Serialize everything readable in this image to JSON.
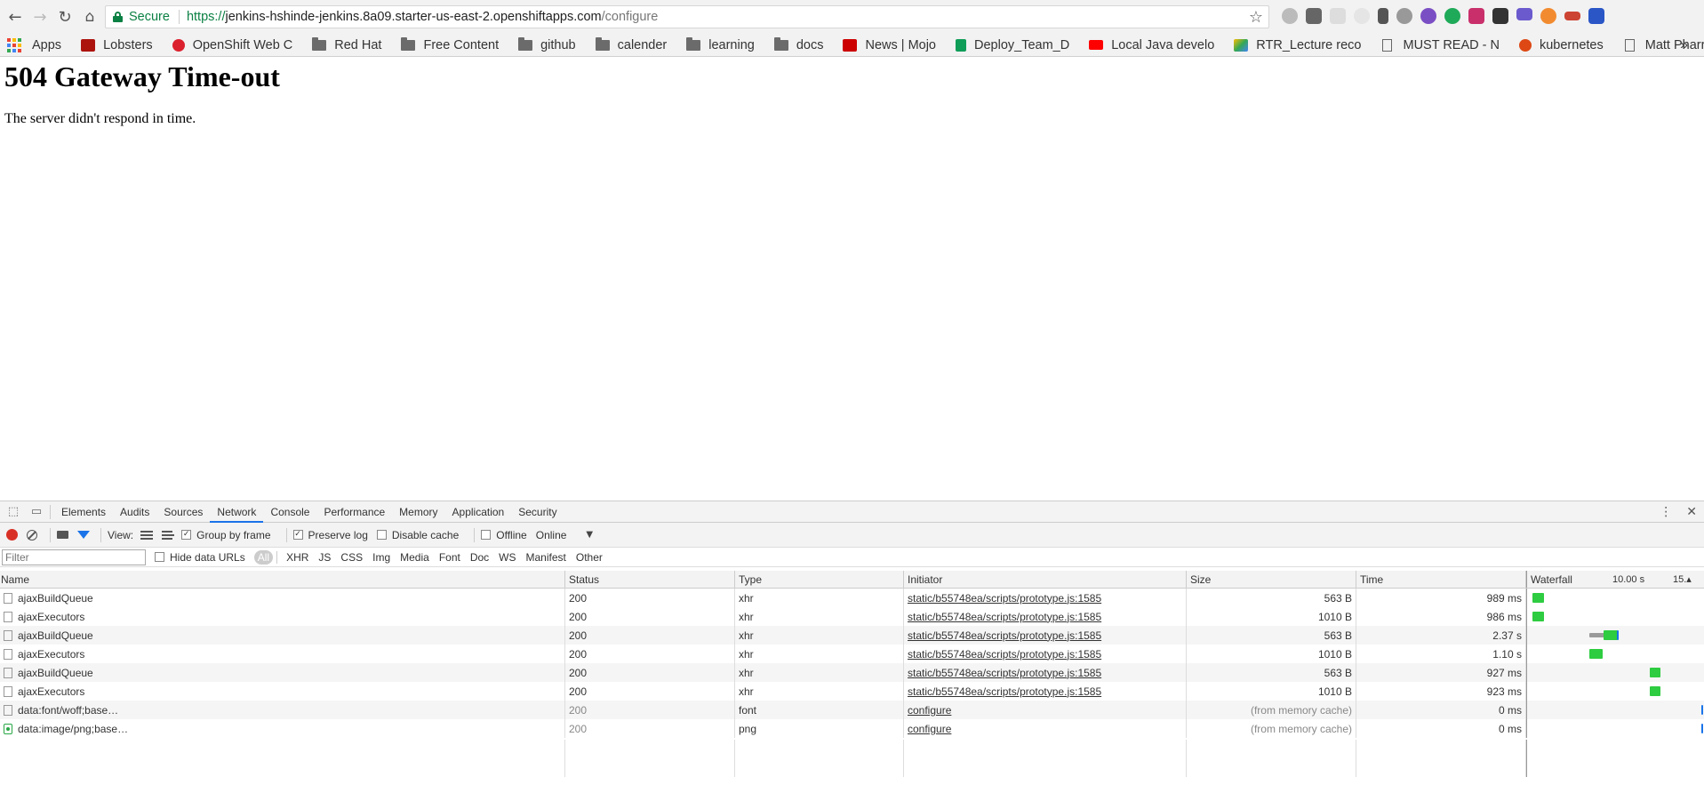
{
  "browser": {
    "secure_label": "Secure",
    "url_scheme": "https://",
    "url_host": "jenkins-hshinde-jenkins.8a09.starter-us-east-2.openshiftapps.com",
    "url_path": "/configure"
  },
  "bookmarks": {
    "apps": "Apps",
    "items": [
      {
        "label": "Lobsters",
        "icon": "lobsters-icon"
      },
      {
        "label": "OpenShift Web C",
        "icon": "openshift-icon"
      },
      {
        "label": "Red Hat",
        "icon": "folder-icon"
      },
      {
        "label": "Free Content",
        "icon": "folder-icon"
      },
      {
        "label": "github",
        "icon": "folder-icon"
      },
      {
        "label": "calender",
        "icon": "folder-icon"
      },
      {
        "label": "learning",
        "icon": "folder-icon"
      },
      {
        "label": "docs",
        "icon": "folder-icon"
      },
      {
        "label": "News | Mojo",
        "icon": "redhat-icon"
      },
      {
        "label": "Deploy_Team_D",
        "icon": "sheets-icon"
      },
      {
        "label": "Local Java develo",
        "icon": "youtube-icon"
      },
      {
        "label": "RTR_Lecture reco",
        "icon": "drive-icon"
      },
      {
        "label": "MUST READ - N",
        "icon": "doc-icon"
      },
      {
        "label": "kubernetes",
        "icon": "ubuntu-icon"
      },
      {
        "label": "Matt Pharr - Goo",
        "icon": "doc-icon"
      }
    ],
    "more": "»"
  },
  "page": {
    "heading": "504 Gateway Time-out",
    "message": "The server didn't respond in time."
  },
  "devtools": {
    "tabs": [
      "Elements",
      "Audits",
      "Sources",
      "Network",
      "Console",
      "Performance",
      "Memory",
      "Application",
      "Security"
    ],
    "active_tab": "Network",
    "toolbar": {
      "view_label": "View:",
      "group_by_frame": "Group by frame",
      "preserve_log": "Preserve log",
      "disable_cache": "Disable cache",
      "offline": "Offline",
      "throttle": "Online"
    },
    "filter": {
      "placeholder": "Filter",
      "hide_data_urls": "Hide data URLs",
      "types": [
        "All",
        "XHR",
        "JS",
        "CSS",
        "Img",
        "Media",
        "Font",
        "Doc",
        "WS",
        "Manifest",
        "Other"
      ]
    },
    "network": {
      "columns": {
        "name": "Name",
        "status": "Status",
        "type": "Type",
        "initiator": "Initiator",
        "size": "Size",
        "time": "Time",
        "waterfall": "Waterfall",
        "tick1": "10.00 s",
        "tick2": "15.▴"
      },
      "rows": [
        {
          "name": "ajaxBuildQueue",
          "status": "200",
          "type": "xhr",
          "initiator": "static/b55748ea/scripts/prototype.js:1585",
          "size": "563 B",
          "time": "989 ms"
        },
        {
          "name": "ajaxExecutors",
          "status": "200",
          "type": "xhr",
          "initiator": "static/b55748ea/scripts/prototype.js:1585",
          "size": "1010 B",
          "time": "986 ms"
        },
        {
          "name": "ajaxBuildQueue",
          "status": "200",
          "type": "xhr",
          "initiator": "static/b55748ea/scripts/prototype.js:1585",
          "size": "563 B",
          "time": "2.37 s"
        },
        {
          "name": "ajaxExecutors",
          "status": "200",
          "type": "xhr",
          "initiator": "static/b55748ea/scripts/prototype.js:1585",
          "size": "1010 B",
          "time": "1.10 s"
        },
        {
          "name": "ajaxBuildQueue",
          "status": "200",
          "type": "xhr",
          "initiator": "static/b55748ea/scripts/prototype.js:1585",
          "size": "563 B",
          "time": "927 ms"
        },
        {
          "name": "ajaxExecutors",
          "status": "200",
          "type": "xhr",
          "initiator": "static/b55748ea/scripts/prototype.js:1585",
          "size": "1010 B",
          "time": "923 ms"
        },
        {
          "name": "data:font/woff;base…",
          "status": "200",
          "type": "font",
          "initiator": "configure",
          "size": "(from memory cache)",
          "time": "0 ms"
        },
        {
          "name": "data:image/png;base…",
          "status": "200",
          "type": "png",
          "initiator": "configure",
          "size": "(from memory cache)",
          "time": "0 ms"
        }
      ]
    }
  }
}
